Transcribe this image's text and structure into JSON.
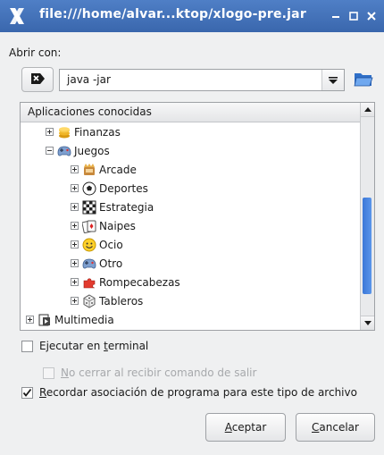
{
  "window": {
    "title": "file:///home/alvar...ktop/xlogo-pre.jar"
  },
  "open_with_label": "Abrir con:",
  "command": {
    "value": "java -jar"
  },
  "tree": {
    "header": "Aplicaciones conocidas",
    "rows": [
      {
        "label": "Finanzas",
        "expander": "plus",
        "level": 1,
        "icon": "coins-icon"
      },
      {
        "label": "Juegos",
        "expander": "minus",
        "level": 1,
        "icon": "gamepad-icon"
      },
      {
        "label": "Arcade",
        "expander": "plus",
        "level": 2,
        "icon": "arcade-icon"
      },
      {
        "label": "Deportes",
        "expander": "plus",
        "level": 2,
        "icon": "soccer-ball-icon"
      },
      {
        "label": "Estrategia",
        "expander": "plus",
        "level": 2,
        "icon": "chess-board-icon"
      },
      {
        "label": "Naipes",
        "expander": "plus",
        "level": 2,
        "icon": "playing-cards-icon"
      },
      {
        "label": "Ocio",
        "expander": "plus",
        "level": 2,
        "icon": "smiley-icon"
      },
      {
        "label": "Otro",
        "expander": "plus",
        "level": 2,
        "icon": "gamepad-icon"
      },
      {
        "label": "Rompecabezas",
        "expander": "plus",
        "level": 2,
        "icon": "puzzle-icon"
      },
      {
        "label": "Tableros",
        "expander": "plus",
        "level": 2,
        "icon": "dice-icon"
      },
      {
        "label": "Multimedia",
        "expander": "plus",
        "level": 0,
        "icon": "multimedia-icon"
      }
    ]
  },
  "options": {
    "run_in_terminal": {
      "before": "Ejecutar en ",
      "mnemonic": "t",
      "after": "erminal",
      "checked": false
    },
    "no_close": {
      "mnemonic": "N",
      "after": "o cerrar al recibir comando de salir",
      "checked": false,
      "disabled": true
    },
    "remember": {
      "mnemonic": "R",
      "after": "ecordar asociación de programa para este tipo de archivo",
      "checked": true
    }
  },
  "buttons": {
    "ok": {
      "mnemonic": "A",
      "after": "ceptar"
    },
    "cancel": {
      "mnemonic": "C",
      "after": "ancelar"
    }
  },
  "colors": {
    "titlebar": "#3a67ad",
    "scroll_thumb": "#3b78d8"
  }
}
